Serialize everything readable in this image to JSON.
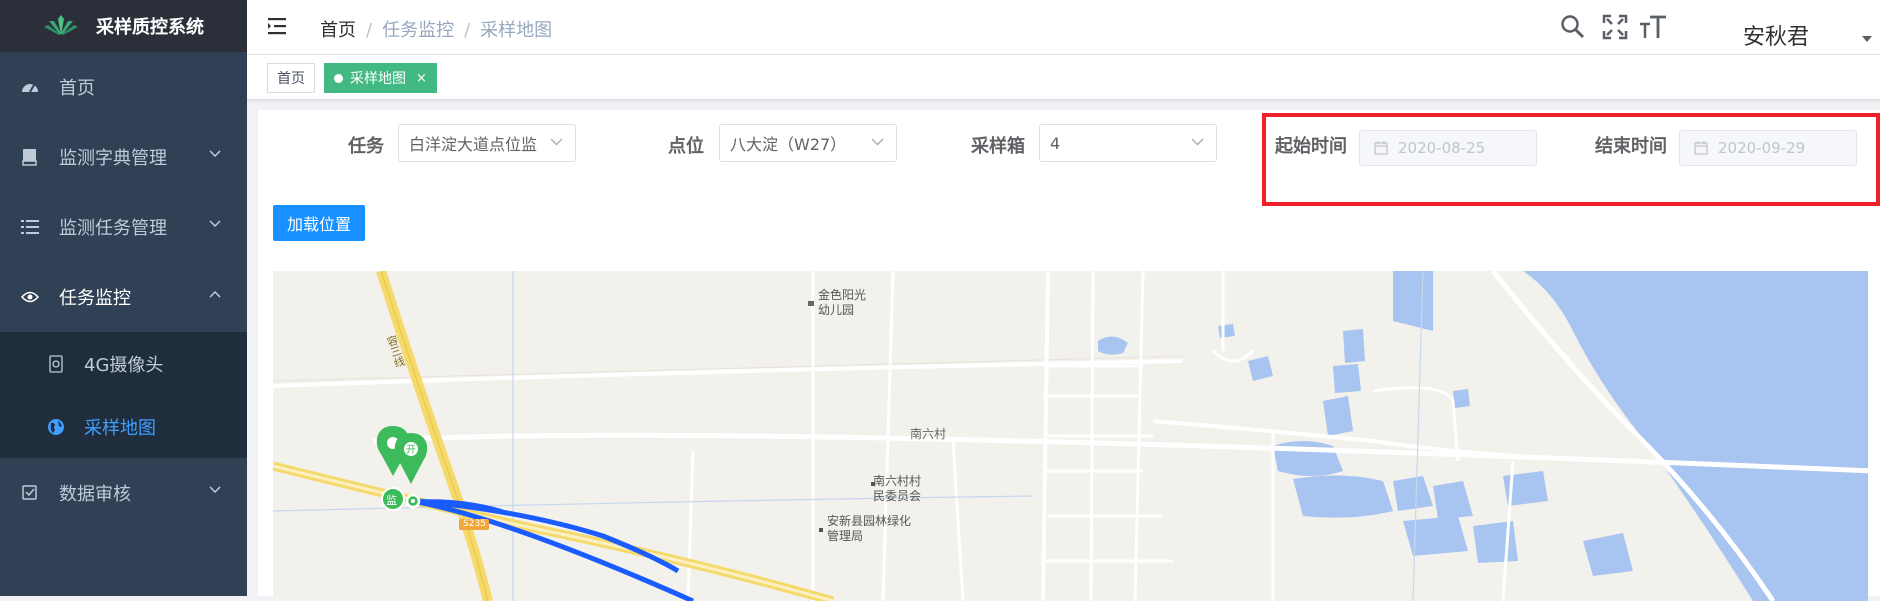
{
  "app": {
    "title": "采样质控系统"
  },
  "sidebar": {
    "items": [
      {
        "label": "首页",
        "icon": "dashboard-icon"
      },
      {
        "label": "监测字典管理",
        "icon": "book-icon"
      },
      {
        "label": "监测任务管理",
        "icon": "list-icon"
      },
      {
        "label": "任务监控",
        "icon": "eye-icon",
        "expanded": true,
        "children": [
          {
            "label": "4G摄像头",
            "icon": "camera-icon"
          },
          {
            "label": "采样地图",
            "icon": "globe-icon",
            "active": true
          }
        ]
      },
      {
        "label": "数据审核",
        "icon": "checkbox-icon"
      }
    ]
  },
  "navbar": {
    "breadcrumb": [
      "首页",
      "任务监控",
      "采样地图"
    ],
    "username": "安秋君"
  },
  "tags": [
    {
      "label": "首页",
      "active": false
    },
    {
      "label": "采样地图",
      "active": true,
      "close": "×"
    }
  ],
  "filters": {
    "task_label": "任务",
    "task_value": "白洋淀大道点位监",
    "point_label": "点位",
    "point_value": "八大淀（W27）",
    "box_label": "采样箱",
    "box_value": "4",
    "start_label": "起始时间",
    "start_value": "2020-08-25",
    "end_label": "结束时间",
    "end_value": "2020-09-29"
  },
  "load_button": "加载位置",
  "map": {
    "labels": {
      "kindergarten": [
        "金色阳光",
        "幼儿园"
      ],
      "road_rongsan": "容三线",
      "village": "南六村",
      "committee": [
        "南六村村",
        "民委员会"
      ],
      "bureau": [
        "安新县园林绿化",
        "管理局"
      ],
      "road_s235": "S235",
      "marker_jian": "监"
    }
  },
  "colors": {
    "sidebar_bg": "#304156",
    "accent": "#409eff",
    "tag_active": "#42b983",
    "button": "#1890ff",
    "highlight": "#f0202a",
    "marker": "#3dbb5c",
    "route": "#1a5cff",
    "water": "#a8c4f0"
  }
}
